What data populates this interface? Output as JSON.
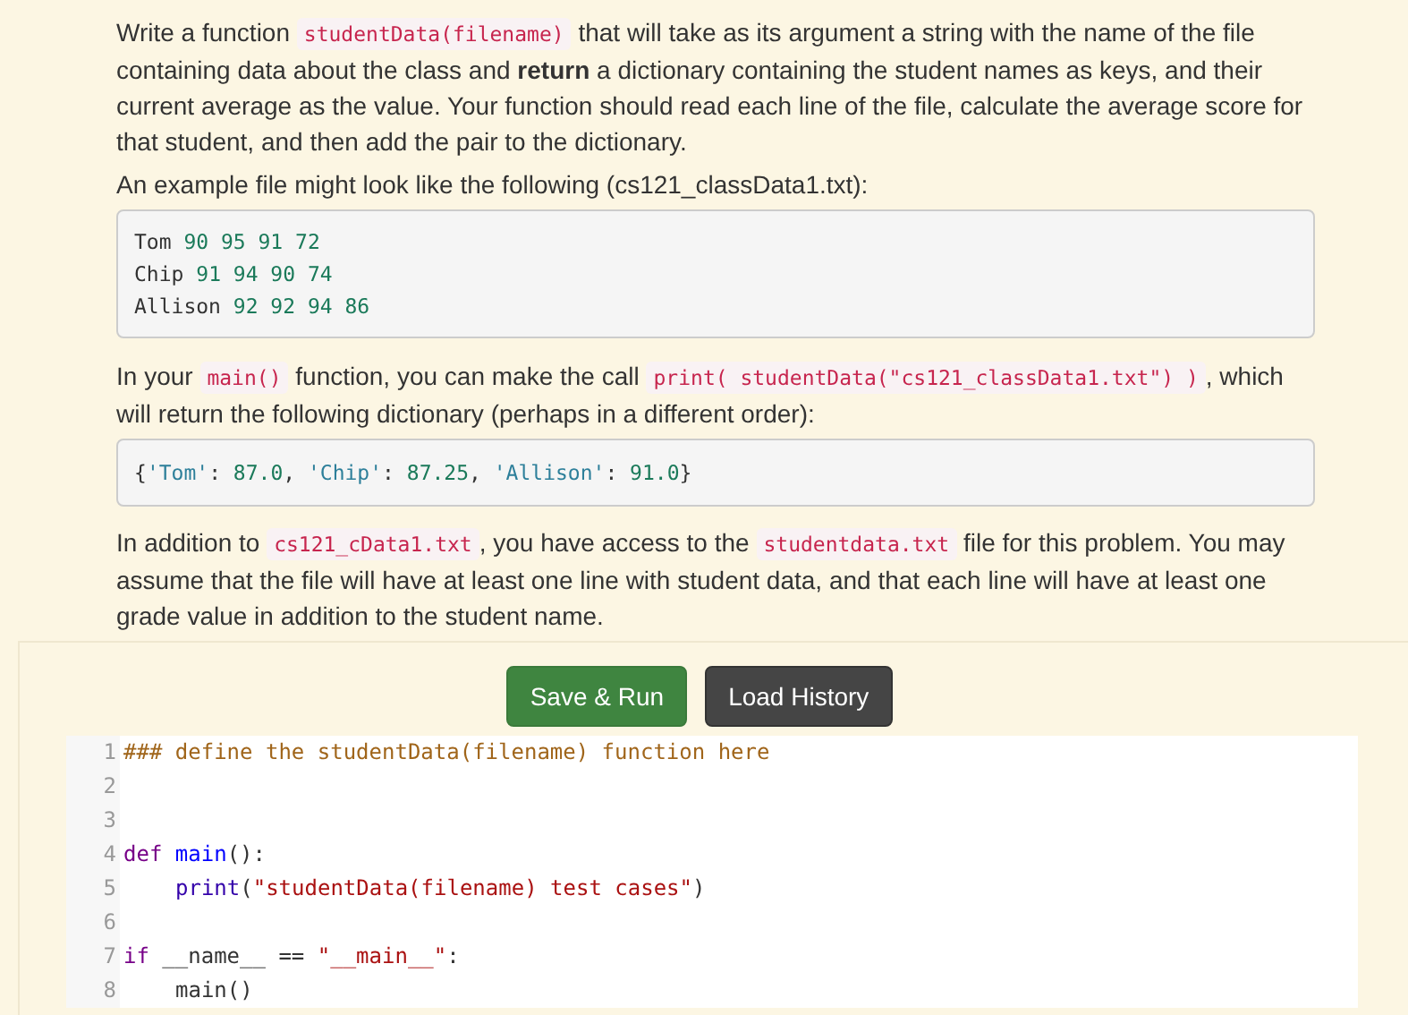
{
  "intro": [
    {
      "kind": "text",
      "text": "Write a function "
    },
    {
      "kind": "code",
      "text": "studentData(filename)"
    },
    {
      "kind": "text",
      "text": " that will take as its argument a string with the name of the file containing data about the class and "
    },
    {
      "kind": "bold",
      "text": "return"
    },
    {
      "kind": "text",
      "text": " a dictionary containing the student names as keys, and their current average as the value. Your function should read each line of the file, calculate the average score for that student, and then add the pair to the dictionary."
    }
  ],
  "example_caption": "An example file might look like the following (cs121_classData1.txt):",
  "example_file": [
    {
      "name": "Tom",
      "scores": "90 95 91 72"
    },
    {
      "name": "Chip",
      "scores": "91 94 90 74"
    },
    {
      "name": "Allison",
      "scores": "92 92 94 86"
    }
  ],
  "call_text": [
    {
      "kind": "text",
      "text": "In your "
    },
    {
      "kind": "code",
      "text": "main()"
    },
    {
      "kind": "text",
      "text": " function, you can make the call "
    },
    {
      "kind": "code",
      "text": "print( studentData(\"cs121_classData1.txt\") )"
    },
    {
      "kind": "text",
      "text": ", which will return the following dictionary (perhaps in a different order):"
    }
  ],
  "output": [
    {
      "kind": "punct",
      "text": "{"
    },
    {
      "kind": "string",
      "text": "'Tom'"
    },
    {
      "kind": "punct",
      "text": ": "
    },
    {
      "kind": "number",
      "text": "87.0"
    },
    {
      "kind": "punct",
      "text": ", "
    },
    {
      "kind": "string",
      "text": "'Chip'"
    },
    {
      "kind": "punct",
      "text": ": "
    },
    {
      "kind": "number",
      "text": "87.25"
    },
    {
      "kind": "punct",
      "text": ", "
    },
    {
      "kind": "string",
      "text": "'Allison'"
    },
    {
      "kind": "punct",
      "text": ": "
    },
    {
      "kind": "number",
      "text": "91.0"
    },
    {
      "kind": "punct",
      "text": "}"
    }
  ],
  "files_text": [
    {
      "kind": "text",
      "text": "In addition to "
    },
    {
      "kind": "code",
      "text": "cs121_cData1.txt"
    },
    {
      "kind": "text",
      "text": ", you have access to the "
    },
    {
      "kind": "code",
      "text": "studentdata.txt"
    },
    {
      "kind": "text",
      "text": " file for this problem. You may assume that the file will have at least one line with student data, and that each line will have at least one grade value in addition to the student name."
    }
  ],
  "buttons": [
    {
      "kind": "primary",
      "label": "Save & Run"
    },
    {
      "kind": "secondary",
      "label": "Load History"
    }
  ],
  "editor": [
    {
      "number": "1",
      "tokens": [
        {
          "kind": "comment",
          "text": "### define the studentData(filename) function here"
        }
      ]
    },
    {
      "number": "2"
    },
    {
      "number": "3"
    },
    {
      "number": "4",
      "tokens": [
        {
          "kind": "keyword",
          "text": "def"
        },
        {
          "kind": "defname",
          "text": " main"
        },
        {
          "kind": "plain",
          "text": "():"
        }
      ]
    },
    {
      "number": "5",
      "indent": true,
      "tokens": [
        {
          "kind": "builtin",
          "text": "print"
        },
        {
          "kind": "plain",
          "text": "("
        },
        {
          "kind": "string",
          "text": "\"studentData(filename) test cases\""
        },
        {
          "kind": "plain",
          "text": ")"
        }
      ]
    },
    {
      "number": "6"
    },
    {
      "number": "7",
      "tokens": [
        {
          "kind": "keyword",
          "text": "if"
        },
        {
          "kind": "plain",
          "text": " __name__ == "
        },
        {
          "kind": "string",
          "text": "\"__main__\""
        },
        {
          "kind": "plain",
          "text": ":"
        }
      ]
    },
    {
      "number": "8",
      "indent": true,
      "tokens": [
        {
          "kind": "plain",
          "text": "main()"
        }
      ]
    }
  ]
}
